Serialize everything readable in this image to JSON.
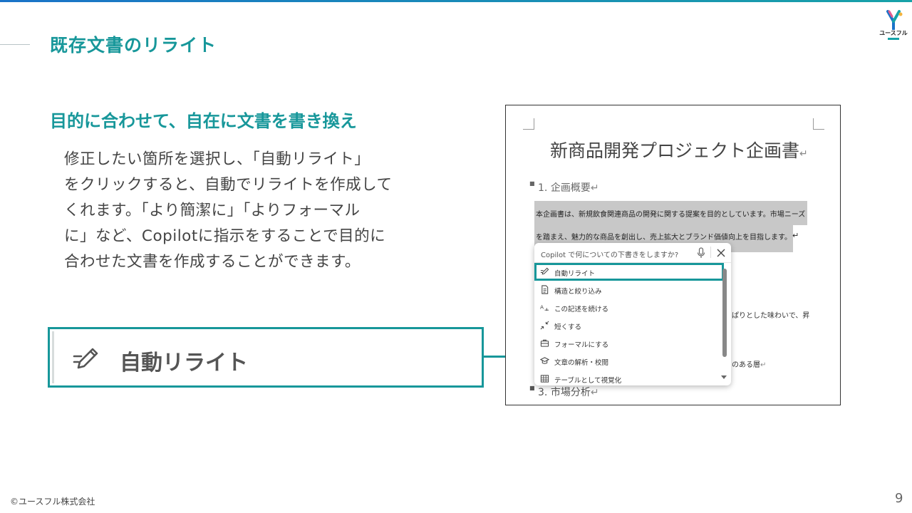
{
  "slide": {
    "title": "既存文書のリライト",
    "subtitle": "目的に合わせて、自在に文書を書き換え",
    "body_lines": [
      "修正したい箇所を選択し、「自動リライト」",
      "をクリックすると、自動でリライトを作成して",
      "くれます。「より簡潔に」「よりフォーマル",
      "に」など、Copilotに指示をすることで目的に",
      "合わせた文書を作成することができます。"
    ],
    "zoom_label": "自動リライト",
    "footer": "©ユースフル株式会社",
    "page_number": "9",
    "logo_text": "ユースフル"
  },
  "document": {
    "title": "新商品開発プロジェクト企画書",
    "return_mark": "↵",
    "heading1": "1. 企画概要",
    "selected_line1": "本企画書は、新規飲食関連商品の開発に関する提案を目的としています。市場ニーズ",
    "selected_line2": "を踏まえ、魅力的な商品を創出し、売上拡大とブランド価値向上を目指します。",
    "fragment1": "ぱりとした味わいで、昇",
    "fragment2": "のある層",
    "heading3": "3. 市場分析"
  },
  "copilot_popup": {
    "prompt": "Copilot で何についての下書きをしますか?",
    "menu_items": [
      {
        "label": "自動リライト",
        "icon": "pen-edit-icon"
      },
      {
        "label": "構造と絞り込み",
        "icon": "document-icon"
      },
      {
        "label": "この記述を続ける",
        "icon": "continue-text-icon"
      },
      {
        "label": "短くする",
        "icon": "shrink-icon"
      },
      {
        "label": "フォーマルにする",
        "icon": "briefcase-icon"
      },
      {
        "label": "文章の解析・校閲",
        "icon": "graduation-cap-icon"
      },
      {
        "label": "テーブルとして視覚化",
        "icon": "table-icon"
      }
    ]
  },
  "colors": {
    "accent": "#17979a",
    "title_gradient_start": "#1a73c8",
    "selection": "#c8c8c8"
  }
}
